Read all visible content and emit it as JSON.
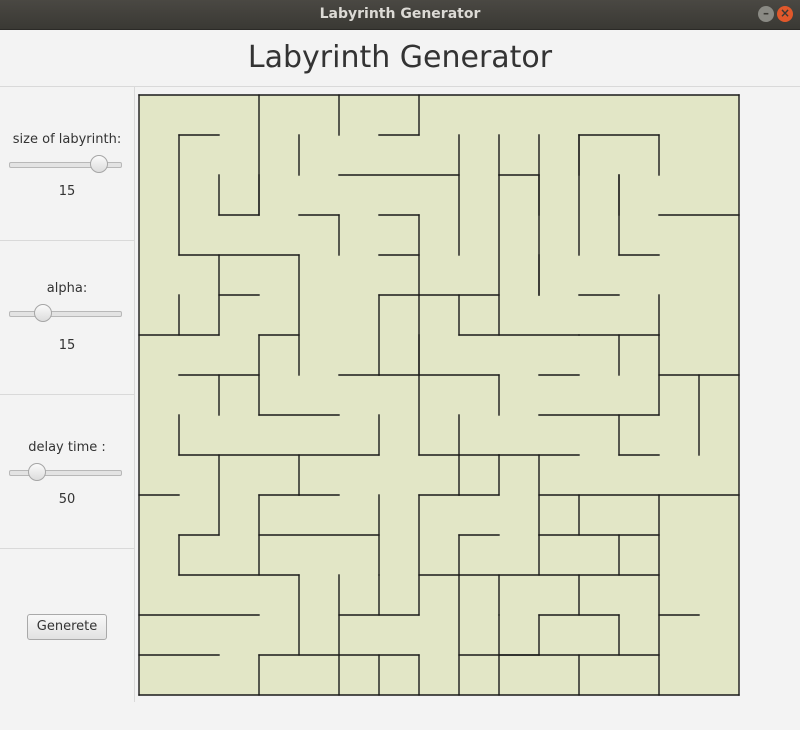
{
  "window": {
    "title": "Labyrinth Generator"
  },
  "header": {
    "title": "Labyrinth Generator"
  },
  "controls": {
    "size": {
      "label": "size of labyrinth:",
      "value": "15",
      "level": 0.8
    },
    "alpha": {
      "label": "alpha:",
      "value": "15",
      "level": 0.3
    },
    "delay": {
      "label": "delay time :",
      "value": "50",
      "level": 0.25
    },
    "generate_label": "Generete"
  },
  "maze": {
    "rows": 15,
    "cols": 15,
    "fill_color": "#e2e6c6",
    "wall_color": "#1a1a1a",
    "walls": [
      [
        0,
        0,
        15,
        0
      ],
      [
        0,
        15,
        15,
        15
      ],
      [
        0,
        0,
        0,
        15
      ],
      [
        15,
        0,
        15,
        15
      ],
      [
        3,
        0,
        3,
        3
      ],
      [
        5,
        0,
        5,
        1
      ],
      [
        7,
        0,
        7,
        1
      ],
      [
        1,
        1,
        2,
        1
      ],
      [
        4,
        1,
        4,
        2
      ],
      [
        6,
        1,
        7,
        1
      ],
      [
        9,
        1,
        9,
        2
      ],
      [
        11,
        1,
        13,
        1
      ],
      [
        1,
        1,
        1,
        4
      ],
      [
        2,
        2,
        2,
        3
      ],
      [
        2,
        3,
        3,
        3
      ],
      [
        3,
        3,
        3,
        2
      ],
      [
        5,
        2,
        8,
        2
      ],
      [
        4,
        3,
        5,
        3
      ],
      [
        5,
        3,
        5,
        4
      ],
      [
        6,
        3,
        7,
        3
      ],
      [
        7,
        3,
        7,
        7
      ],
      [
        9,
        2,
        10,
        2
      ],
      [
        10,
        2,
        10,
        3
      ],
      [
        11,
        1,
        11,
        2
      ],
      [
        12,
        2,
        12,
        3
      ],
      [
        13,
        1,
        13,
        2
      ],
      [
        13,
        3,
        15,
        3
      ],
      [
        1,
        4,
        4,
        4
      ],
      [
        2,
        4,
        2,
        6
      ],
      [
        2,
        5,
        3,
        5
      ],
      [
        4,
        4,
        4,
        7
      ],
      [
        6,
        4,
        7,
        4
      ],
      [
        8,
        1,
        8,
        4
      ],
      [
        9,
        2,
        9,
        6
      ],
      [
        10,
        1,
        10,
        5
      ],
      [
        11,
        1,
        11,
        4
      ],
      [
        12,
        2,
        12,
        4
      ],
      [
        12,
        4,
        13,
        4
      ],
      [
        1,
        5,
        1,
        6
      ],
      [
        0,
        6,
        2,
        6
      ],
      [
        3,
        6,
        4,
        6
      ],
      [
        6,
        5,
        7,
        5
      ],
      [
        6,
        5,
        6,
        7
      ],
      [
        7,
        5,
        9,
        5
      ],
      [
        8,
        5,
        8,
        6
      ],
      [
        8,
        6,
        11,
        6
      ],
      [
        10,
        4,
        10,
        5
      ],
      [
        11,
        5,
        12,
        5
      ],
      [
        13,
        5,
        13,
        6
      ],
      [
        11,
        6,
        13,
        6
      ],
      [
        3,
        6,
        3,
        8
      ],
      [
        5,
        7,
        6,
        7
      ],
      [
        7,
        6,
        7,
        9
      ],
      [
        1,
        7,
        3,
        7
      ],
      [
        2,
        7,
        2,
        8
      ],
      [
        3,
        8,
        5,
        8
      ],
      [
        6,
        7,
        9,
        7
      ],
      [
        9,
        7,
        9,
        8
      ],
      [
        7,
        9,
        9,
        9
      ],
      [
        10,
        7,
        11,
        7
      ],
      [
        10,
        8,
        13,
        8
      ],
      [
        13,
        7,
        15,
        7
      ],
      [
        13,
        6,
        13,
        8
      ],
      [
        12,
        6,
        12,
        7
      ],
      [
        1,
        8,
        1,
        9
      ],
      [
        1,
        9,
        6,
        9
      ],
      [
        2,
        9,
        2,
        11
      ],
      [
        4,
        9,
        4,
        10
      ],
      [
        4,
        10,
        5,
        10
      ],
      [
        6,
        8,
        6,
        9
      ],
      [
        8,
        8,
        8,
        9
      ],
      [
        8,
        9,
        8,
        10
      ],
      [
        8,
        10,
        9,
        10
      ],
      [
        9,
        10,
        9,
        9
      ],
      [
        9,
        9,
        11,
        9
      ],
      [
        10,
        9,
        10,
        11
      ],
      [
        10,
        10,
        15,
        10
      ],
      [
        12,
        8,
        12,
        9
      ],
      [
        12,
        9,
        13,
        9
      ],
      [
        14,
        7,
        14,
        9
      ],
      [
        0,
        10,
        1,
        10
      ],
      [
        3,
        10,
        3,
        12
      ],
      [
        3,
        10,
        4,
        10
      ],
      [
        6,
        10,
        6,
        12
      ],
      [
        7,
        10,
        7,
        13
      ],
      [
        8,
        11,
        9,
        11
      ],
      [
        7,
        10,
        8,
        10
      ],
      [
        11,
        10,
        11,
        11
      ],
      [
        13,
        10,
        13,
        15
      ],
      [
        1,
        11,
        2,
        11
      ],
      [
        1,
        11,
        1,
        12
      ],
      [
        1,
        12,
        4,
        12
      ],
      [
        3,
        11,
        6,
        11
      ],
      [
        4,
        12,
        4,
        14
      ],
      [
        6,
        12,
        6,
        13
      ],
      [
        8,
        11,
        8,
        12
      ],
      [
        7,
        12,
        13,
        12
      ],
      [
        9,
        12,
        9,
        13
      ],
      [
        10,
        11,
        13,
        11
      ],
      [
        10,
        11,
        10,
        12
      ],
      [
        12,
        11,
        12,
        12
      ],
      [
        11,
        12,
        11,
        13
      ],
      [
        0,
        13,
        3,
        13
      ],
      [
        5,
        13,
        7,
        13
      ],
      [
        5,
        12,
        5,
        15
      ],
      [
        7,
        14,
        7,
        15
      ],
      [
        9,
        13,
        9,
        15
      ],
      [
        10,
        13,
        12,
        13
      ],
      [
        10,
        13,
        10,
        14
      ],
      [
        12,
        13,
        12,
        14
      ],
      [
        13,
        13,
        14,
        13
      ],
      [
        0,
        14,
        2,
        14
      ],
      [
        3,
        14,
        7,
        14
      ],
      [
        3,
        14,
        3,
        15
      ],
      [
        6,
        14,
        6,
        15
      ],
      [
        9,
        14,
        13,
        14
      ],
      [
        11,
        14,
        11,
        15
      ],
      [
        8,
        12,
        8,
        15
      ],
      [
        8,
        14,
        10,
        14
      ]
    ]
  }
}
